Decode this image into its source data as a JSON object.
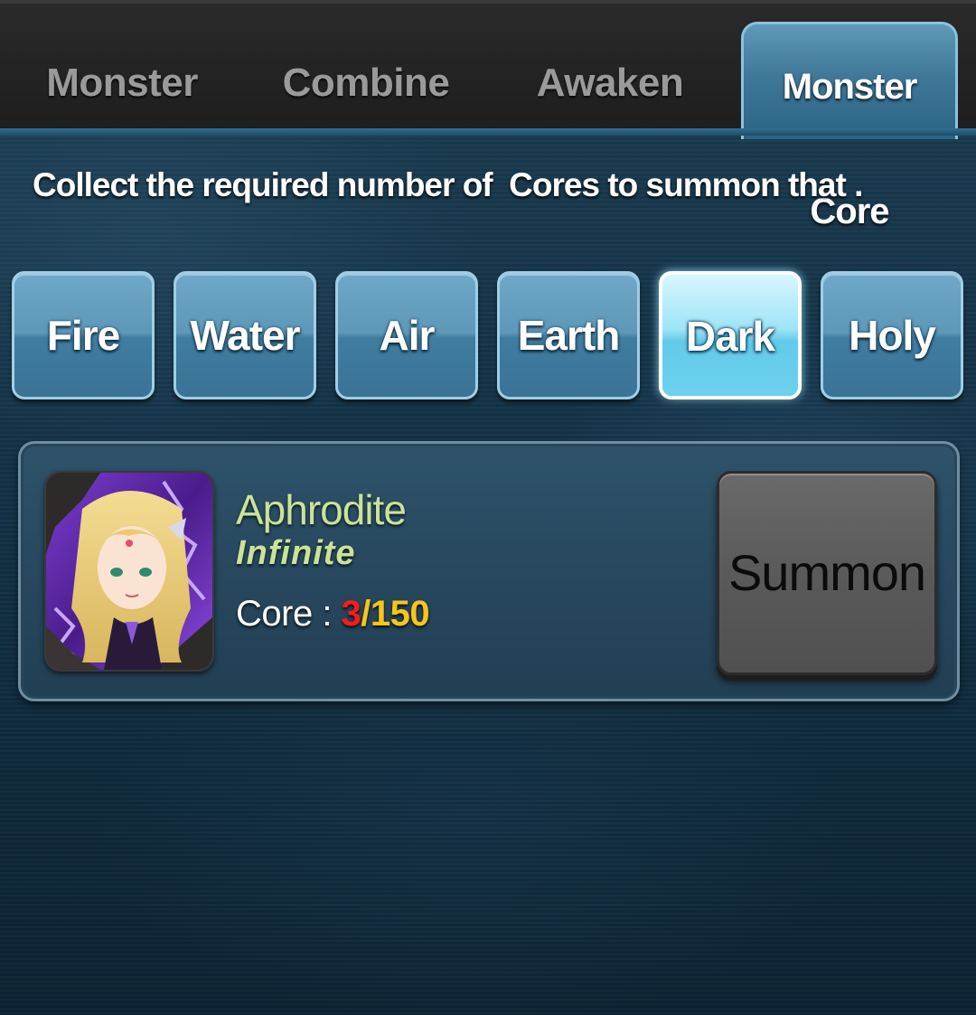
{
  "tabs": [
    {
      "label": "Monster"
    },
    {
      "label": "Combine"
    },
    {
      "label": "Awaken"
    },
    {
      "label": "Monster Core",
      "active": true
    }
  ],
  "instruction": "Collect the required number of  Cores to summon that .",
  "elements": [
    {
      "label": "Fire"
    },
    {
      "label": "Water"
    },
    {
      "label": "Air"
    },
    {
      "label": "Earth"
    },
    {
      "label": "Dark",
      "selected": true
    },
    {
      "label": "Holy"
    }
  ],
  "monster": {
    "name": "Aphrodite",
    "rank": "Infinite",
    "core_label": "Core : ",
    "core_current": "3",
    "core_separator": "/",
    "core_total": "150",
    "portrait_icon": "aphrodite-portrait"
  },
  "summon_button": "Summon",
  "colors": {
    "accent_tab": "#3f7898",
    "element_selected": "#9ee4f7",
    "name_color": "#c9e39a",
    "core_current": "#ff1a1a",
    "core_total": "#f7c51a"
  }
}
